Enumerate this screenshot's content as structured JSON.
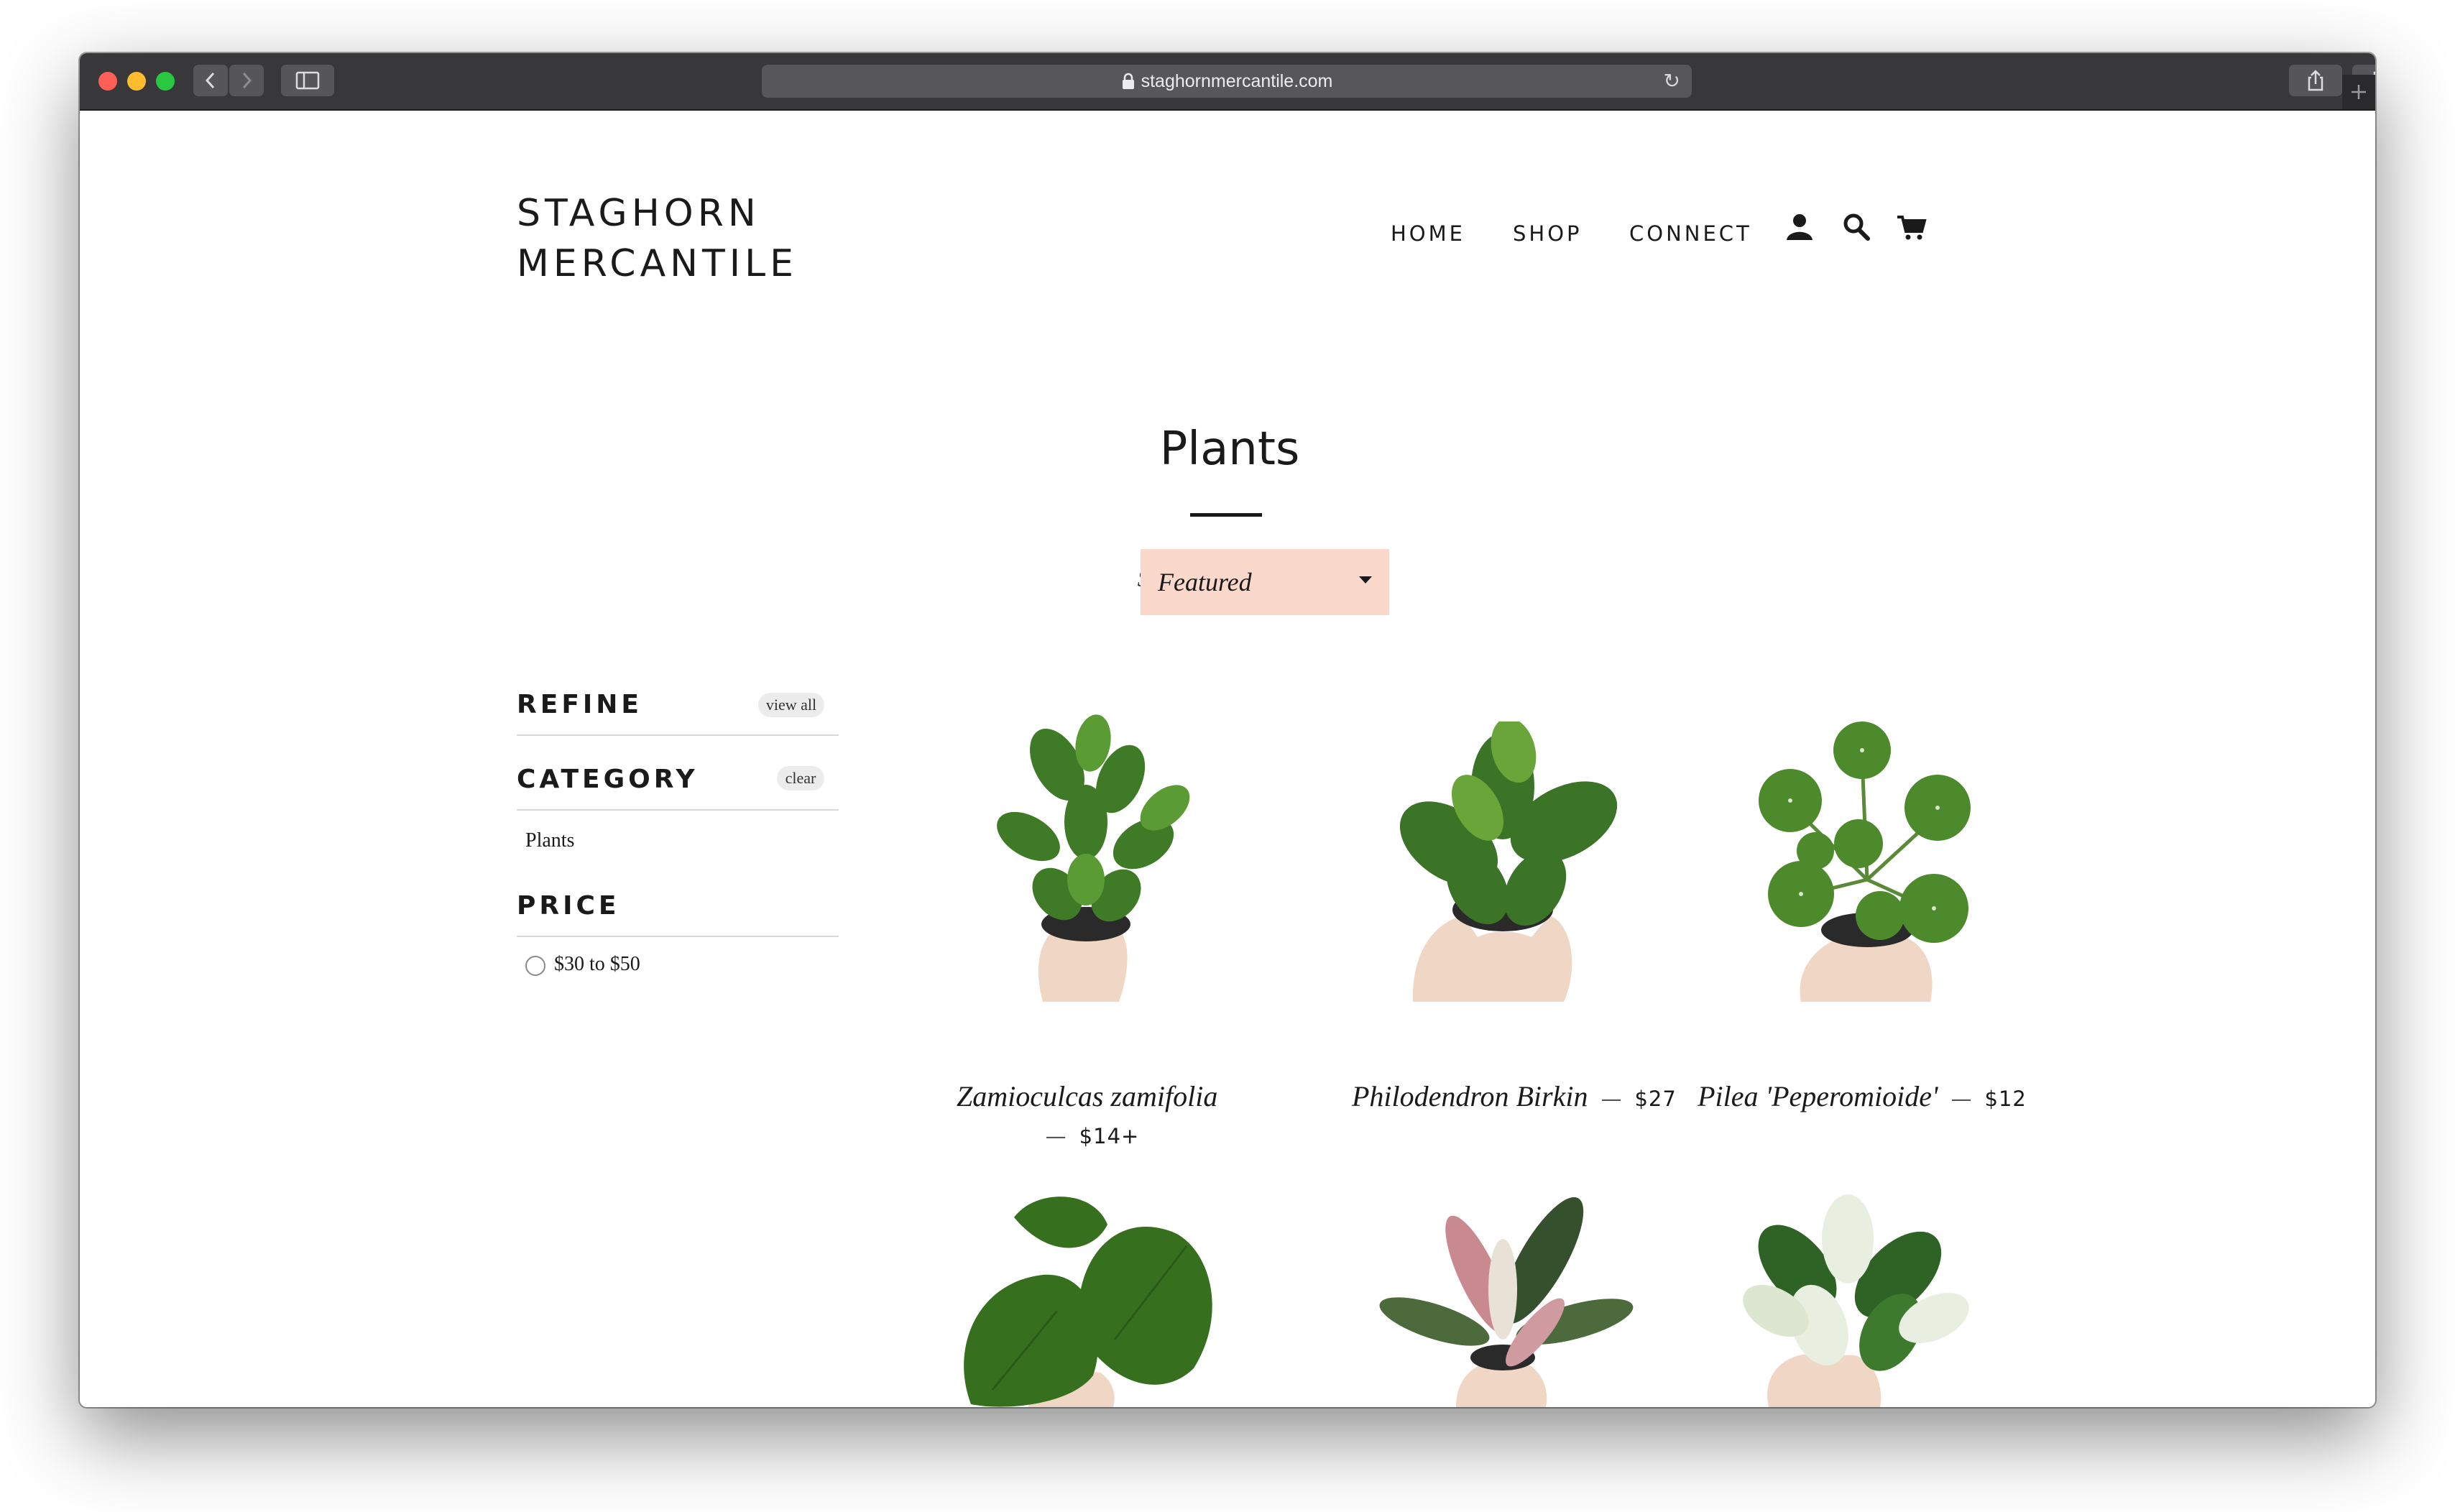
{
  "browser": {
    "url": "staghornmercantile.com",
    "lock_icon": "lock-icon",
    "reload_icon": "reload-icon"
  },
  "site": {
    "logo_line1": "STAGHORN",
    "logo_line2": "MERCANTILE",
    "nav": [
      "HOME",
      "SHOP",
      "CONNECT"
    ],
    "nav_icons": [
      "account-icon",
      "search-icon",
      "cart-icon"
    ]
  },
  "collection": {
    "title": "Plants",
    "sort_label": "Sort by",
    "sort_value": "Featured"
  },
  "sidebar": {
    "refine": {
      "title": "REFINE",
      "action": "view all"
    },
    "category": {
      "title": "CATEGORY",
      "action": "clear",
      "items": [
        "Plants"
      ]
    },
    "price": {
      "title": "PRICE",
      "options": [
        "$30 to $50"
      ]
    }
  },
  "products": [
    {
      "name": "Zamioculcas zamifolia",
      "price": "$14+"
    },
    {
      "name": "Philodendron Birkin",
      "price": "$27"
    },
    {
      "name": "Pilea 'Peperomioide'",
      "price": "$12"
    },
    {
      "name": "",
      "price": ""
    },
    {
      "name": "",
      "price": ""
    },
    {
      "name": "",
      "price": ""
    }
  ],
  "colors": {
    "chrome": "#38383b",
    "sort_bg": "#fad9cc",
    "leaf": "#3f7a27",
    "text": "#1a1a1a"
  }
}
